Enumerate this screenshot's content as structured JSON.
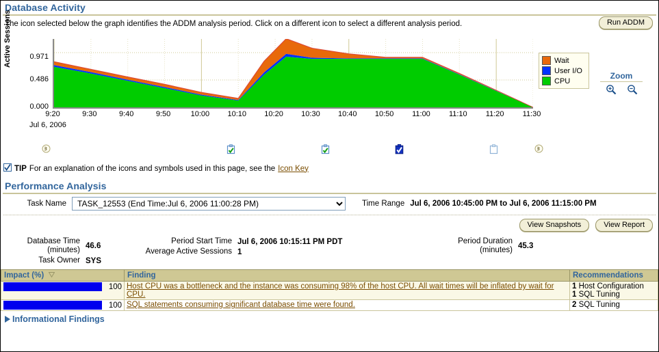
{
  "db_activity": {
    "title": "Database Activity",
    "run_addm_label": "Run ADDM",
    "intro": "The icon selected below the graph identifies the ADDM analysis period. Click on a different icon to select a different analysis period.",
    "zoom_label": "Zoom",
    "zoom_in_icon": "zoom-in-icon",
    "zoom_out_icon": "zoom-out-icon"
  },
  "tip": {
    "tip_icon": "tip-checkbox-icon",
    "label": "TIP",
    "text": "For an explanation of the icons and symbols used in this page, see the",
    "link": "Icon Key"
  },
  "performance_analysis": {
    "title": "Performance Analysis",
    "task_name_label": "Task Name",
    "task_name_value": "TASK_12553 (End Time:Jul 6, 2006 11:00:28 PM)",
    "time_range_label": "Time Range",
    "time_range_value": "Jul 6, 2006 10:45:00 PM to Jul 6, 2006 11:15:00 PM",
    "view_snapshots_label": "View Snapshots",
    "view_report_label": "View Report",
    "metrics": [
      {
        "label_line1": "Database Time",
        "label_line2": "(minutes)",
        "value": "46.6"
      },
      {
        "label_line1": "Task Owner",
        "label_line2": "",
        "value": "SYS"
      },
      {
        "label_line1": "Period Start Time",
        "label_line2": "",
        "value": "Jul 6, 2006 10:15:11 PM PDT"
      },
      {
        "label_line1": "Average Active Sessions",
        "label_line2": "",
        "value": "1"
      },
      {
        "label_line1": "Period Duration",
        "label_line2": "(minutes)",
        "value": "45.3"
      }
    ]
  },
  "findings_table": {
    "columns": [
      "Impact (%)",
      "Finding",
      "Recommendations"
    ],
    "sort_icon": "sort-descending-icon",
    "rows": [
      {
        "impact": 100,
        "impact_text": "100",
        "finding": "Host CPU was a bottleneck and the instance was consuming 98% of the host CPU. All wait times will be inflated by wait for CPU.",
        "recommendations": [
          {
            "count": "1",
            "text": "Host Configuration"
          },
          {
            "count": "1",
            "text": "SQL Tuning"
          }
        ]
      },
      {
        "impact": 100,
        "impact_text": "100",
        "finding": "SQL statements consuming significant database time were found.",
        "recommendations": [
          {
            "count": "2",
            "text": "SQL Tuning"
          }
        ]
      }
    ]
  },
  "informational_findings": {
    "label": "Informational Findings",
    "expand_icon": "expand-triangle-icon"
  },
  "icon_strip": {
    "items": [
      {
        "x": 60,
        "type": "snapshot-circle",
        "selected": false
      },
      {
        "x": 330,
        "type": "clipboard-green",
        "selected": false
      },
      {
        "x": 468,
        "type": "clipboard-green",
        "selected": false
      },
      {
        "x": 576,
        "type": "clipboard-selected",
        "selected": true
      },
      {
        "x": 714,
        "type": "clipboard-empty",
        "selected": false
      },
      {
        "x": 780,
        "type": "snapshot-circle",
        "selected": false
      }
    ]
  },
  "chart_data": {
    "type": "area",
    "title": "",
    "xlabel": "Jul 6, 2006",
    "ylabel": "Active Sessions",
    "ylim": [
      0.0,
      1.214
    ],
    "yticks": [
      "0.000",
      "0.486",
      "0.971"
    ],
    "ytick_values": [
      0.0,
      0.486,
      0.971
    ],
    "categories": [
      "9:20",
      "9:30",
      "9:40",
      "9:50",
      "10:00",
      "10:10",
      "10:20",
      "10:30",
      "10:40",
      "10:50",
      "11:00",
      "11:10",
      "11:20",
      "11:30"
    ],
    "x_values": [
      0,
      10,
      20,
      30,
      40,
      50,
      55,
      60,
      70,
      80,
      90,
      100,
      110,
      120,
      130
    ],
    "x_tick_labels": [
      "9:20",
      "9:30",
      "9:40",
      "9:50",
      "10:00",
      "10:10",
      "10:20",
      "10:30",
      "10:40",
      "10:50",
      "11:00",
      "11:10",
      "11:20",
      "11:30"
    ],
    "stacked": true,
    "legend_position": "right",
    "grid": true,
    "series": [
      {
        "name": "CPU",
        "color": "#00CC00",
        "values": [
          0.72,
          0.6,
          0.47,
          0.34,
          0.21,
          0.12,
          0.58,
          0.9,
          0.86,
          0.86,
          0.86,
          0.86,
          0.86,
          0.58,
          0.29,
          0.0
        ]
      },
      {
        "name": "User I/O",
        "color": "#0033FF",
        "values": [
          0.03,
          0.025,
          0.02,
          0.02,
          0.015,
          0.01,
          0.04,
          0.05,
          0.02,
          0.01,
          0.01,
          0.01,
          0.01,
          0.008,
          0.005,
          0.0
        ]
      },
      {
        "name": "Wait",
        "color": "#E8690B",
        "values": [
          0.06,
          0.05,
          0.05,
          0.05,
          0.04,
          0.03,
          0.2,
          0.27,
          0.17,
          0.08,
          0.02,
          0.02,
          0.02,
          0.015,
          0.008,
          0.0
        ]
      }
    ],
    "sample_x": [
      0,
      10,
      20,
      30,
      40,
      50,
      57,
      63,
      70,
      80,
      90,
      95,
      100,
      110,
      120,
      130
    ],
    "legend": [
      {
        "name": "Wait",
        "color": "#E8690B"
      },
      {
        "name": "User I/O",
        "color": "#0033FF"
      },
      {
        "name": "CPU",
        "color": "#00CC00"
      }
    ]
  }
}
